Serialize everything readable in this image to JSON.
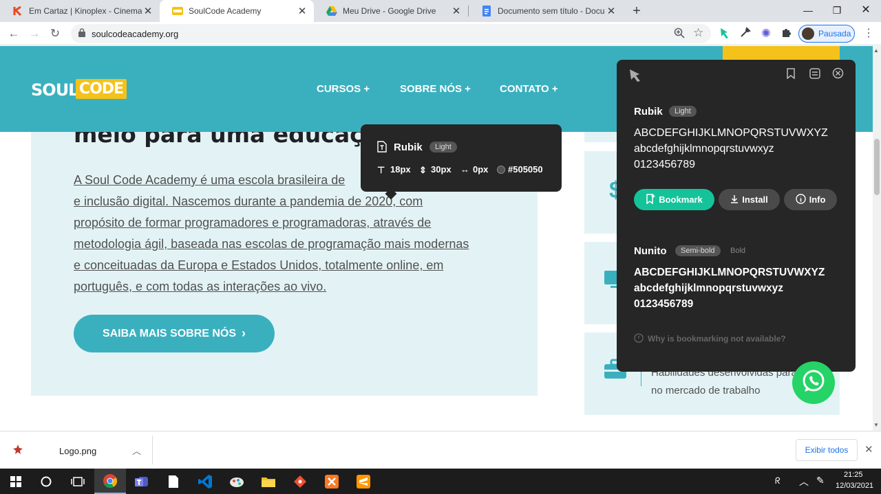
{
  "browser": {
    "tabs": [
      {
        "title": "Em Cartaz | Kinoplex - Cinema ao",
        "favicon": "kinoplex-icon",
        "color": "#e8491d"
      },
      {
        "title": "SoulCode Academy",
        "favicon": "soulcode-icon",
        "color": "#f4c21a"
      },
      {
        "title": "Meu Drive - Google Drive",
        "favicon": "google-drive-icon",
        "color": "#1fa463"
      },
      {
        "title": "Documento sem título - Docume",
        "favicon": "google-docs-icon",
        "color": "#4285f4"
      }
    ],
    "new_tab": "+",
    "url": "soulcodeacademy.org",
    "profile_label": "Pausada"
  },
  "site": {
    "logo_left": "SOUL",
    "logo_right": "CODE",
    "nav": [
      "CURSOS +",
      "SOBRE NÓS +",
      "CONTATO +"
    ],
    "headline": "meio para uma educação",
    "paragraph_lines": [
      "A Soul Code Academy é uma escola brasileira de",
      "e inclusão digital. Nascemos durante a pandemia de 2020, com",
      "propósito de formar programadores e programadoras, através de",
      "metodologia ágil, baseada nas escolas de programação mais modernas",
      "e conceituadas da Europa e Estados Unidos, totalmente online, em",
      "português, e com todas as interações ao vivo."
    ],
    "cta_label": "SAIBA MAIS SOBRE NÓS",
    "right_card_text": "Habilidades desenvolvidas para atuar no mercado de trabalho"
  },
  "inspector_tip": {
    "font_name": "Rubik",
    "weight": "Light",
    "size": "18px",
    "line_height": "30px",
    "letter_spacing": "0px",
    "color_hex": "#505050"
  },
  "font_panel": {
    "fonts": [
      {
        "name": "Rubik",
        "weight": "Light",
        "uppercase": "ABCDEFGHIJKLMNOPQRSTUVWXYZ",
        "lowercase": "abcdefghijklmnopqrstuvwxyz",
        "digits": "0123456789"
      },
      {
        "name": "Nunito",
        "weight": "Semi-bold",
        "alt_weight": "Bold",
        "uppercase": "ABCDEFGHIJKLMNOPQRSTUVWXYZ",
        "lowercase": "abcdefghijklmnopqrstuvwxyz",
        "digits": "0123456789"
      }
    ],
    "bookmark_label": "Bookmark",
    "install_label": "Install",
    "info_label": "Info",
    "note": "Why is bookmarking not available?",
    "accent": "#14c39a"
  },
  "download_bar": {
    "file_name": "Logo.png",
    "show_all": "Exibir todos"
  },
  "taskbar": {
    "time": "21:25",
    "date": "12/03/2021"
  }
}
